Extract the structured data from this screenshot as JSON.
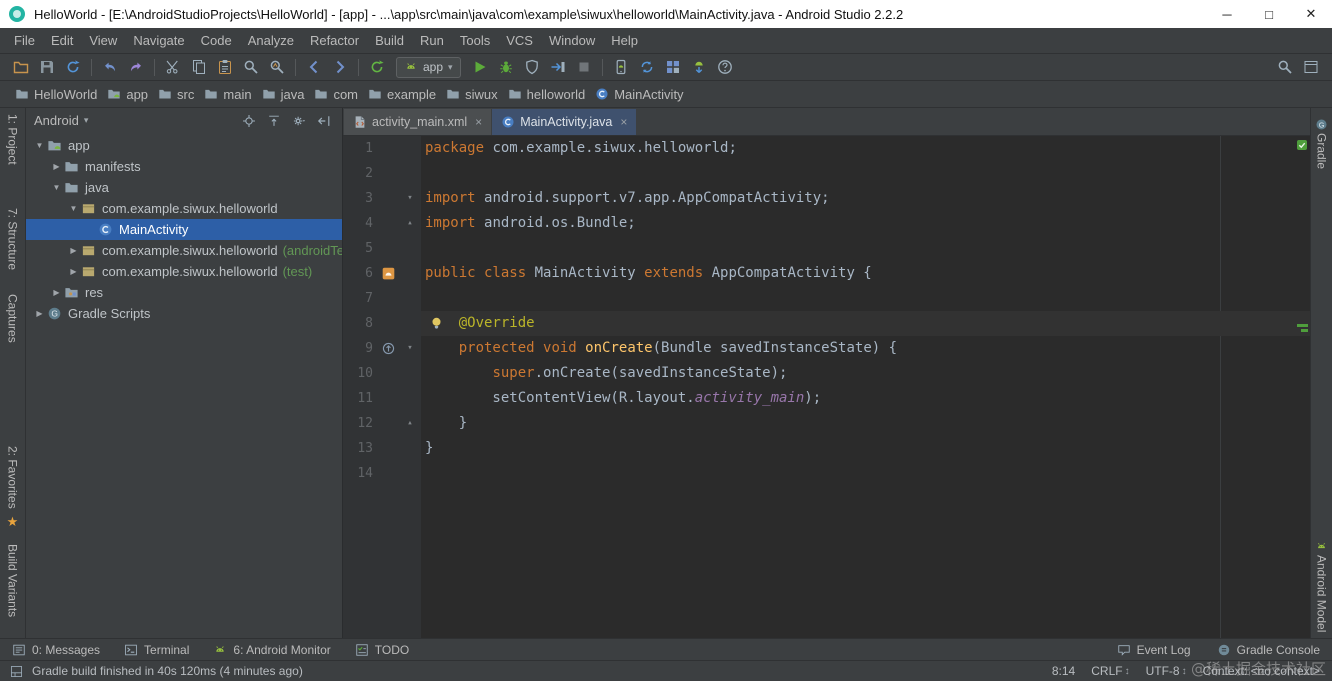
{
  "window": {
    "title": "HelloWorld - [E:\\AndroidStudioProjects\\HelloWorld] - [app] - ...\\app\\src\\main\\java\\com\\example\\siwux\\helloworld\\MainActivity.java - Android Studio 2.2.2",
    "controls": {
      "minimize": "─",
      "maximize": "□",
      "close": "✕"
    }
  },
  "menubar": {
    "items": [
      "File",
      "Edit",
      "View",
      "Navigate",
      "Code",
      "Analyze",
      "Refactor",
      "Build",
      "Run",
      "Tools",
      "VCS",
      "Window",
      "Help"
    ]
  },
  "toolbar": {
    "run_config": "app",
    "items": [
      "open",
      "save",
      "sync",
      "|",
      "undo",
      "redo",
      "|",
      "cut",
      "copy",
      "paste",
      "find",
      "replace",
      "|",
      "back",
      "forward",
      "|",
      "gradle-sync",
      "COMBO",
      "run",
      "debug",
      "coverage",
      "attach",
      "stop",
      "|",
      "avd",
      "sync-project",
      "project-structure",
      "sdk",
      "help"
    ],
    "right_items": [
      "search",
      "window"
    ]
  },
  "breadcrumbs": [
    {
      "label": "HelloWorld",
      "icon": "folder"
    },
    {
      "label": "app",
      "icon": "module"
    },
    {
      "label": "src",
      "icon": "folder"
    },
    {
      "label": "main",
      "icon": "folder"
    },
    {
      "label": "java",
      "icon": "folder"
    },
    {
      "label": "com",
      "icon": "folder"
    },
    {
      "label": "example",
      "icon": "folder"
    },
    {
      "label": "siwux",
      "icon": "folder"
    },
    {
      "label": "helloworld",
      "icon": "folder"
    },
    {
      "label": "MainActivity",
      "icon": "class"
    }
  ],
  "left_strip": [
    {
      "label": "1: Project"
    },
    {
      "label": "7: Structure"
    },
    {
      "label": "Captures"
    },
    {
      "label": "2: Favorites"
    },
    {
      "label": "Build Variants"
    }
  ],
  "right_strip": [
    {
      "label": "Gradle",
      "icon": "gradle"
    },
    {
      "label": "Android Model",
      "icon": "android"
    }
  ],
  "project_panel": {
    "selector": "Android",
    "selector_caret": "▾",
    "tree": [
      {
        "label": "app",
        "depth": 0,
        "expanded": true,
        "icon": "module"
      },
      {
        "label": "manifests",
        "depth": 1,
        "expanded": false,
        "icon": "folder"
      },
      {
        "label": "java",
        "depth": 1,
        "expanded": true,
        "icon": "folder"
      },
      {
        "label": "com.example.siwux.helloworld",
        "depth": 2,
        "expanded": true,
        "icon": "package"
      },
      {
        "label": "MainActivity",
        "depth": 3,
        "icon": "class",
        "selected": true
      },
      {
        "label": "com.example.siwux.helloworld",
        "extra": "(androidTest)",
        "depth": 2,
        "expanded": false,
        "icon": "package"
      },
      {
        "label": "com.example.siwux.helloworld",
        "extra": "(test)",
        "depth": 2,
        "expanded": false,
        "icon": "package"
      },
      {
        "label": "res",
        "depth": 1,
        "expanded": false,
        "icon": "res"
      },
      {
        "label": "Gradle Scripts",
        "depth": 0,
        "expanded": false,
        "icon": "gradle"
      }
    ]
  },
  "editor": {
    "tabs": [
      {
        "label": "activity_main.xml",
        "icon": "xmlfile",
        "active": false
      },
      {
        "label": "MainActivity.java",
        "icon": "class",
        "active": true
      }
    ],
    "lines": [
      {
        "n": 1,
        "tokens": [
          [
            "kw",
            "package "
          ],
          [
            "plain",
            "com.example.siwux.helloworld;"
          ]
        ]
      },
      {
        "n": 2,
        "tokens": []
      },
      {
        "n": 3,
        "fold": "open",
        "tokens": [
          [
            "kw",
            "import "
          ],
          [
            "plain",
            "android.support.v7.app.AppCompatActivity;"
          ]
        ]
      },
      {
        "n": 4,
        "fold": "close",
        "tokens": [
          [
            "kw",
            "import "
          ],
          [
            "plain",
            "android.os.Bundle;"
          ]
        ]
      },
      {
        "n": 5,
        "tokens": []
      },
      {
        "n": 6,
        "gutter": "activity",
        "tokens": [
          [
            "kw",
            "public class "
          ],
          [
            "plain",
            "MainActivity "
          ],
          [
            "kw",
            "extends "
          ],
          [
            "plain",
            "AppCompatActivity {"
          ]
        ]
      },
      {
        "n": 7,
        "tokens": []
      },
      {
        "n": 8,
        "caret": true,
        "bulb": true,
        "tokens": [
          [
            "plain",
            "    "
          ],
          [
            "anno",
            "@Override"
          ]
        ]
      },
      {
        "n": 9,
        "gutter": "override",
        "fold": "open",
        "tokens": [
          [
            "plain",
            "    "
          ],
          [
            "kw",
            "protected "
          ],
          [
            "kw",
            "void "
          ],
          [
            "method",
            "onCreate"
          ],
          [
            "plain",
            "(Bundle savedInstanceState) {"
          ]
        ]
      },
      {
        "n": 10,
        "tokens": [
          [
            "plain",
            "        "
          ],
          [
            "kw",
            "super"
          ],
          [
            "plain",
            ".onCreate(savedInstanceState);"
          ]
        ]
      },
      {
        "n": 11,
        "tokens": [
          [
            "plain",
            "        setContentView(R.layout."
          ],
          [
            "field",
            "activity_main"
          ],
          [
            "plain",
            ");"
          ]
        ]
      },
      {
        "n": 12,
        "fold": "close",
        "tokens": [
          [
            "plain",
            "    }"
          ]
        ]
      },
      {
        "n": 13,
        "tokens": [
          [
            "plain",
            "}"
          ]
        ]
      },
      {
        "n": 14,
        "tokens": []
      }
    ]
  },
  "bottom_bar": {
    "left": [
      {
        "label": "0: Messages",
        "icon": "messages"
      },
      {
        "label": "Terminal",
        "icon": "terminal"
      },
      {
        "label": "6: Android Monitor",
        "icon": "android"
      },
      {
        "label": "TODO",
        "icon": "todo"
      }
    ],
    "right": [
      {
        "label": "Event Log",
        "icon": "eventlog"
      },
      {
        "label": "Gradle Console",
        "icon": "console"
      }
    ]
  },
  "status_bar": {
    "message": "Gradle build finished in 40s 120ms (4 minutes ago)",
    "caret_position": "8:14",
    "line_separator": "CRLF",
    "line_separator_toggle": "↕",
    "encoding": "UTF-8",
    "encoding_toggle": "↕",
    "context": "Context: <no context>"
  },
  "watermark": "@稀土掘金技术社区",
  "colors": {
    "keyword": "#cc7832",
    "annotation": "#bbb529",
    "method": "#ffc66b",
    "field_italic": "#9876aa",
    "plain": "#a9b7c6",
    "selection_blue": "#2d5fa7",
    "editor_bg": "#2b2b2b",
    "panel_bg": "#3c3f41",
    "run_green": "#5cab3a"
  }
}
